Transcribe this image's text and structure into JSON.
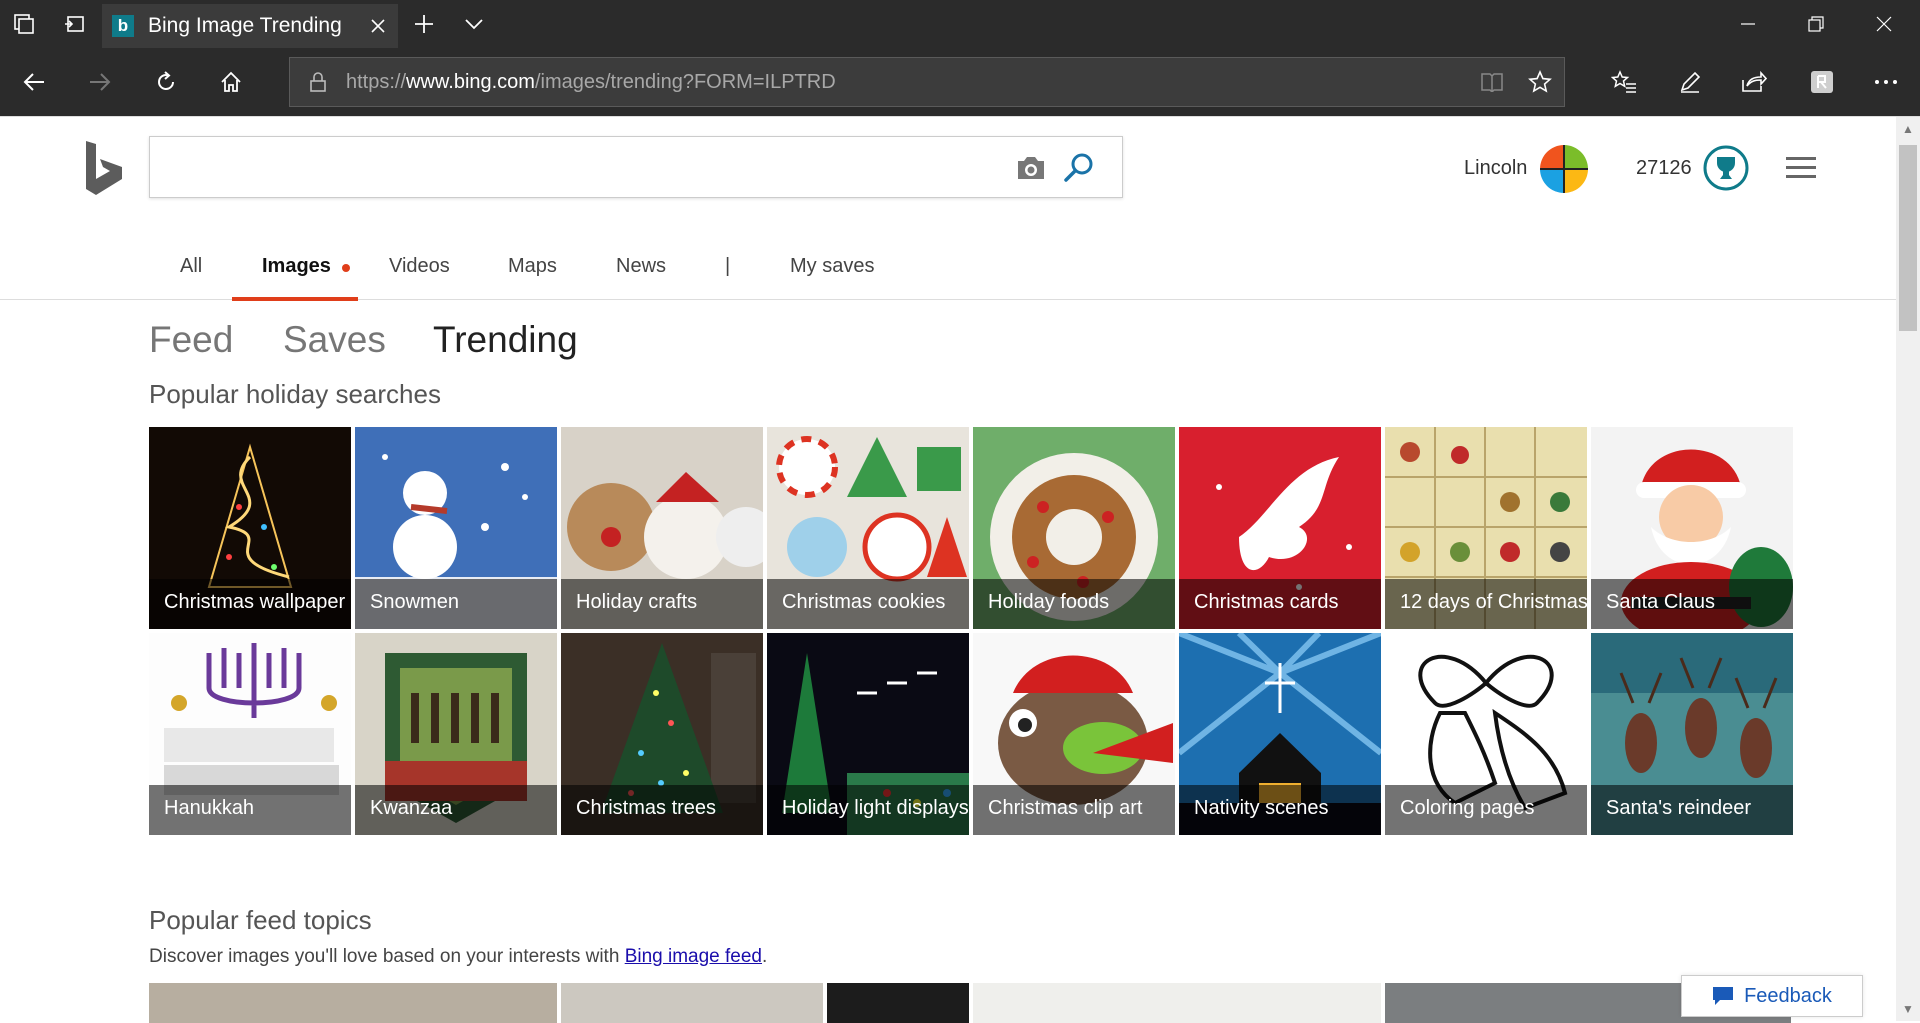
{
  "browser": {
    "tab_title": "Bing Image Trending",
    "url_prefix": "https://",
    "url_domain": "www.bing.com",
    "url_path": "/images/trending?FORM=ILPTRD"
  },
  "header": {
    "user_name": "Lincoln",
    "points": "27126"
  },
  "scopes": [
    {
      "label": "All"
    },
    {
      "label": "Images"
    },
    {
      "label": "Videos"
    },
    {
      "label": "Maps"
    },
    {
      "label": "News"
    },
    {
      "label": "|"
    },
    {
      "label": "My saves"
    }
  ],
  "subtabs": [
    {
      "label": "Feed"
    },
    {
      "label": "Saves"
    },
    {
      "label": "Trending"
    }
  ],
  "holiday": {
    "title": "Popular holiday searches",
    "tiles": [
      {
        "label": "Christmas wallpaper",
        "color": "#1a0f08"
      },
      {
        "label": "Snowmen",
        "color": "#3f6fb8"
      },
      {
        "label": "Holiday crafts",
        "color": "#d8d2c8"
      },
      {
        "label": "Christmas cookies",
        "color": "#e8e4dc"
      },
      {
        "label": "Holiday foods",
        "color": "#6fae6a"
      },
      {
        "label": "Christmas cards",
        "color": "#d81f2e"
      },
      {
        "label": "12 days of Christmas",
        "color": "#e9dfae"
      },
      {
        "label": "Santa Claus",
        "color": "#f3f3f3"
      },
      {
        "label": "Hanukkah",
        "color": "#fdfdfd"
      },
      {
        "label": "Kwanzaa",
        "color": "#d8d4c8"
      },
      {
        "label": "Christmas trees",
        "color": "#3b2f26"
      },
      {
        "label": "Holiday light displays",
        "color": "#0a0a14"
      },
      {
        "label": "Christmas clip art",
        "color": "#f8f8f8"
      },
      {
        "label": "Nativity scenes",
        "color": "#1d6fb0"
      },
      {
        "label": "Coloring pages",
        "color": "#ffffff"
      },
      {
        "label": "Santa's reindeer",
        "color": "#4a8d92"
      }
    ]
  },
  "feed": {
    "title": "Popular feed topics",
    "desc_prefix": "Discover images you'll love based on your interests with ",
    "desc_link": "Bing image feed",
    "desc_suffix": "."
  },
  "feedback_label": "Feedback",
  "colors": {
    "accent": "#e03e1a",
    "bing_teal": "#0f7b8a",
    "link": "#1a0dab"
  }
}
